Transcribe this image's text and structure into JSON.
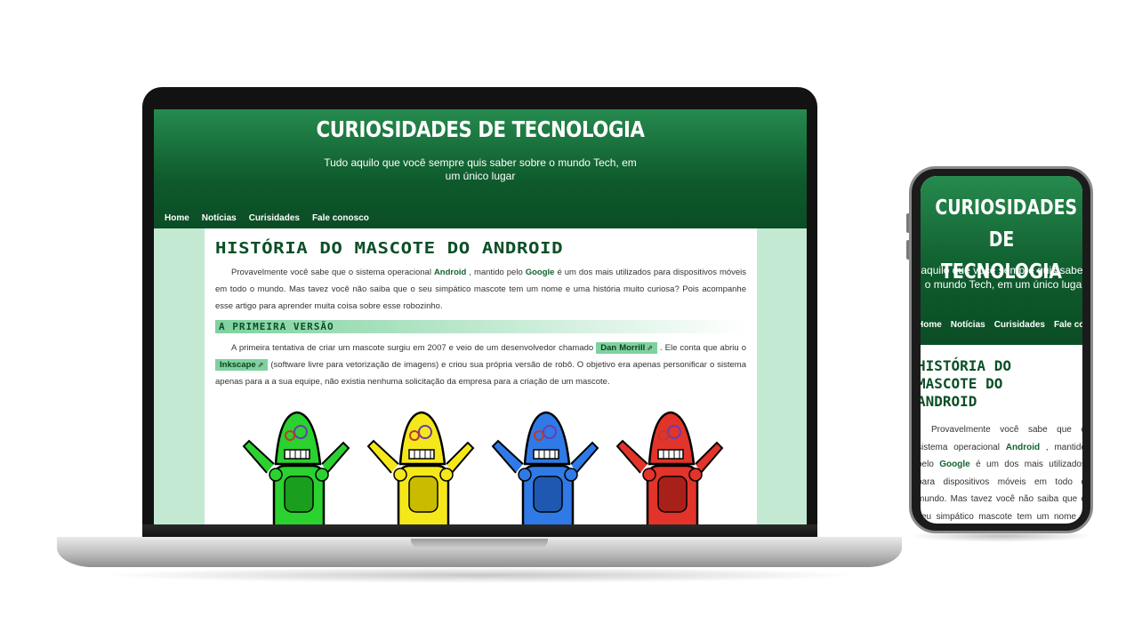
{
  "site": {
    "title": "CURIOSIDADES DE TECNOLOGIA",
    "subtitle": "Tudo aquilo que você sempre quis saber sobre o mundo Tech, em um único lugar",
    "nav": [
      "Home",
      "Notícias",
      "Curisidades",
      "Fale conosco"
    ]
  },
  "article": {
    "title": "História do Mascote do Android",
    "intro": {
      "pre": "Provavelmente você sabe que o sistema operacional",
      "kw1": "Android",
      "mid": ", mantido pelo",
      "kw2": "Google",
      "post": "é um dos mais utilizados para dispositivos móveis em todo o mundo. Mas tavez você não saiba que o seu simpático mascote tem um nome e uma história muito curiosa? Pois acompanhe esse artigo para aprender muita coisa sobre esse robozinho."
    },
    "section1": {
      "heading": "A Primeira Versão",
      "pre": "A primeira tentativa de criar um mascote surgiu em 2007 e veio de um desenvolvedor chamado",
      "link1": "Dan Morrill",
      "mid": ". Ele conta que abriu o",
      "link2": "Inkscape",
      "post": "(software livre para vetorização de imagens) e criou sua própria versão de robô. O objetivo era apenas personificar o sistema apenas para a a sua equipe, não existia nenhuma solicitação da empresa para a criação de um mascote."
    },
    "robots": [
      {
        "color": "#2bd12f",
        "dark": "#1a9e1e"
      },
      {
        "color": "#f4e81a",
        "dark": "#c9bc00"
      },
      {
        "color": "#2f7ae6",
        "dark": "#1f58b0"
      },
      {
        "color": "#e2342a",
        "dark": "#a8201a"
      }
    ]
  },
  "phone": {
    "title": "CURIOSIDADES DE TECNOLOGIA",
    "subtitle": "Tudo aquilo que você sempre quis saber sobre o mundo Tech, em um único lugar",
    "nav": [
      "Home",
      "Notícias",
      "Curisidades",
      "Fale conosco"
    ],
    "article_title": "História do Mascote do Android",
    "p_pre": "Provavelmente você sabe que o sistema operacional",
    "p_kw1": "Android",
    "p_mid": ", mantido pelo",
    "p_kw2": "Google",
    "p_post": "é um dos mais utilizados para dispositivos móveis em todo o mundo. Mas tavez você não saiba que o seu simpático mascote tem um nome e uma história muito curiosa? Pois"
  },
  "icons": {
    "external_link": "external-link-icon"
  }
}
